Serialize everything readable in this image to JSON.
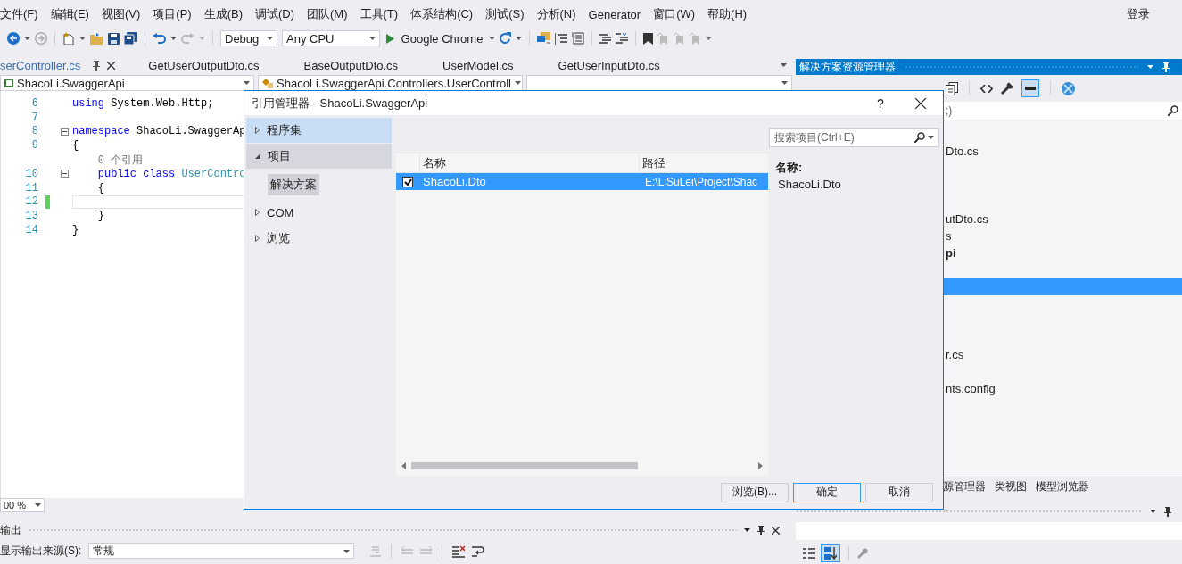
{
  "menu_bar": {
    "items": [
      "文件(F)",
      "编辑(E)",
      "视图(V)",
      "项目(P)",
      "生成(B)",
      "调试(D)",
      "团队(M)",
      "工具(T)",
      "体系结构(C)",
      "测试(S)",
      "分析(N)",
      "Generator",
      "窗口(W)",
      "帮助(H)"
    ],
    "sign_in": "登录"
  },
  "toolbar": {
    "configuration": "Debug",
    "platform": "Any CPU",
    "start_target": "Google Chrome"
  },
  "document_tabs": [
    {
      "label": "serController.cs",
      "selected": true
    },
    {
      "label": "GetUserOutputDto.cs",
      "selected": false
    },
    {
      "label": "BaseOutputDto.cs",
      "selected": false
    },
    {
      "label": "UserModel.cs",
      "selected": false
    },
    {
      "label": "GetUserInputDto.cs",
      "selected": false
    }
  ],
  "navigation_bar": {
    "project": "ShacoLi.SwaggerApi",
    "type": "ShacoLi.SwaggerApi.Controllers.UserControll"
  },
  "editor": {
    "lines": [
      {
        "kind": "code",
        "number": "6",
        "tokens": [
          {
            "text": "using",
            "kind": "keyword"
          },
          {
            "text": " System.Web.Http;",
            "kind": "plain"
          }
        ]
      },
      {
        "kind": "code",
        "number": "7"
      },
      {
        "kind": "code",
        "number": "8",
        "collapsible": true,
        "tokens": [
          {
            "text": "namespace",
            "kind": "keyword"
          },
          {
            "text": " ShacoLi.SwaggerAp",
            "kind": "plain"
          }
        ]
      },
      {
        "kind": "code",
        "number": "9",
        "tokens": [
          {
            "text": "{",
            "kind": "plain"
          }
        ]
      },
      {
        "kind": "codelens",
        "text": "    0 个引用"
      },
      {
        "kind": "code",
        "number": "10",
        "collapsible": true,
        "tokens": [
          {
            "text": "    public class",
            "kind": "keyword"
          },
          {
            "text": " UserContro",
            "kind": "type"
          }
        ]
      },
      {
        "kind": "code",
        "number": "11",
        "tokens": [
          {
            "text": "    {",
            "kind": "plain"
          }
        ]
      },
      {
        "kind": "code",
        "number": "12",
        "current": true,
        "modified": true
      },
      {
        "kind": "code",
        "number": "13",
        "tokens": [
          {
            "text": "    }",
            "kind": "plain"
          }
        ]
      },
      {
        "kind": "code",
        "number": "14",
        "tokens": [
          {
            "text": "}",
            "kind": "plain"
          }
        ]
      }
    ],
    "zoom": "00 %"
  },
  "output_panel": {
    "title": "输出",
    "source_label": "显示输出来源(S):",
    "source": "常规"
  },
  "solution_explorer": {
    "title": "解决方案资源管理器",
    "search_fragment": ";)",
    "rows": [
      {
        "selected": false
      },
      {
        "text": "Dto.cs",
        "bold": false,
        "selected": false
      },
      {
        "selected": false
      },
      {
        "selected": false
      },
      {
        "selected": false
      },
      {
        "text": "utDto.cs",
        "bold": false,
        "selected": false
      },
      {
        "text": "s",
        "bold": false,
        "selected": false
      },
      {
        "text": "pi",
        "bold": true,
        "selected": false
      },
      {
        "selected": false
      },
      {
        "selected": true
      },
      {
        "selected": false
      },
      {
        "selected": false
      },
      {
        "selected": false
      },
      {
        "text": "r.cs",
        "bold": false,
        "selected": false
      },
      {
        "selected": false
      },
      {
        "text": "nts.config",
        "bold": false,
        "selected": false
      }
    ]
  },
  "panel_tabs": [
    "源管理器",
    "类视图",
    "模型浏览器"
  ],
  "properties_panel": {
    "alphabetical": true
  },
  "dialog": {
    "title": "引用管理器 - ShacoLi.SwaggerApi",
    "help": "?",
    "categories": [
      {
        "label": "程序集",
        "expanded": false,
        "hovered": true
      },
      {
        "label": "项目",
        "expanded": true,
        "hovered": false,
        "children": [
          {
            "label": "解决方案",
            "selected": true
          }
        ]
      },
      {
        "label": "COM",
        "expanded": false,
        "hovered": false
      },
      {
        "label": "浏览",
        "expanded": false,
        "hovered": false
      }
    ],
    "search": {
      "placeholder": "搜索项目(Ctrl+E)"
    },
    "columns": [
      "名称",
      "路径"
    ],
    "rows": [
      {
        "checked": true,
        "selected": true,
        "name": "ShacoLi.Dto",
        "path": "E:\\LiSuLei\\Project\\Shac"
      }
    ],
    "details": {
      "label": "名称:",
      "value": "ShacoLi.Dto"
    },
    "buttons": [
      {
        "label": "浏览(B)...",
        "default": false
      },
      {
        "label": "确定",
        "default": true
      },
      {
        "label": "取消",
        "default": false
      }
    ]
  }
}
